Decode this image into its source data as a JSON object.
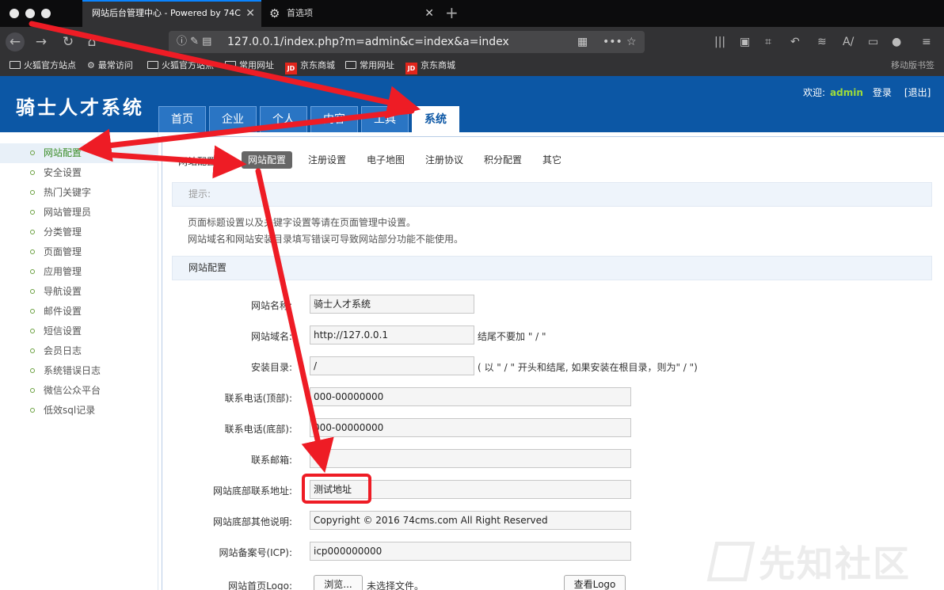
{
  "browser": {
    "tabs": [
      {
        "label": "网站后台管理中心 - Powered by 74C",
        "active": true
      },
      {
        "label": "首选项",
        "active": false
      }
    ],
    "url_bar": {
      "url": "127.0.0.1/index.php?m=admin&c=index&a=index"
    },
    "bookmarks": [
      "火狐官方站点",
      "最常访问",
      "火狐官方站点",
      "常用网址",
      "京东商城",
      "常用网址",
      "京东商城"
    ],
    "jd_badge": "JD",
    "mobile_bookmarks": "移动版书签"
  },
  "header": {
    "logo": "骑士人才系统",
    "welcome_label": "欢迎:",
    "username": "admin",
    "login": "登录",
    "logout": "[退出]"
  },
  "main_nav": [
    "首页",
    "企业",
    "个人",
    "内容",
    "工具",
    "系统"
  ],
  "main_nav_active": "系统",
  "sidebar": {
    "items": [
      "网站配置",
      "安全设置",
      "热门关键字",
      "网站管理员",
      "分类管理",
      "页面管理",
      "应用管理",
      "导航设置",
      "邮件设置",
      "短信设置",
      "会员日志",
      "系统错误日志",
      "微信公众平台",
      "低效sql记录"
    ],
    "active": "网站配置"
  },
  "content": {
    "subnav_label": "网站配置",
    "subnav": [
      "网站配置",
      "注册设置",
      "电子地图",
      "注册协议",
      "积分配置",
      "其它"
    ],
    "subnav_active": "网站配置",
    "hint_title": "提示:",
    "hints": [
      "页面标题设置以及关键字设置等请在页面管理中设置。",
      "网站域名和网站安装目录填写错误可导致网站部分功能不能使用。"
    ],
    "section_title": "网站配置",
    "form": {
      "site_name": {
        "label": "网站名称:",
        "value": "骑士人才系统"
      },
      "site_domain": {
        "label": "网站域名:",
        "value": "http://127.0.0.1",
        "note": "结尾不要加 \" / \""
      },
      "install_dir": {
        "label": "安装目录:",
        "value": "/",
        "note": "( 以 \" / \" 开头和结尾, 如果安装在根目录，则为\" / \")"
      },
      "phone_top": {
        "label": "联系电话(顶部):",
        "value": "000-00000000"
      },
      "phone_bottom": {
        "label": "联系电话(底部):",
        "value": "000-00000000"
      },
      "email": {
        "label": "联系邮箱:",
        "value": ""
      },
      "footer_address": {
        "label": "网站底部联系地址:",
        "value": "测试地址"
      },
      "footer_other": {
        "label": "网站底部其他说明:",
        "value": "Copyright © 2016 74cms.com All Right Reserved"
      },
      "icp": {
        "label": "网站备案号(ICP):",
        "value": "icp000000000"
      },
      "logo": {
        "label": "网站首页Logo:",
        "browse": "浏览...",
        "file_status": "未选择文件。",
        "view": "查看Logo"
      }
    }
  },
  "watermark": "先知社区",
  "colors": {
    "header_blue": "#0c57a5",
    "annotation_red": "#ee1c25",
    "active_green": "#3a8c28"
  }
}
